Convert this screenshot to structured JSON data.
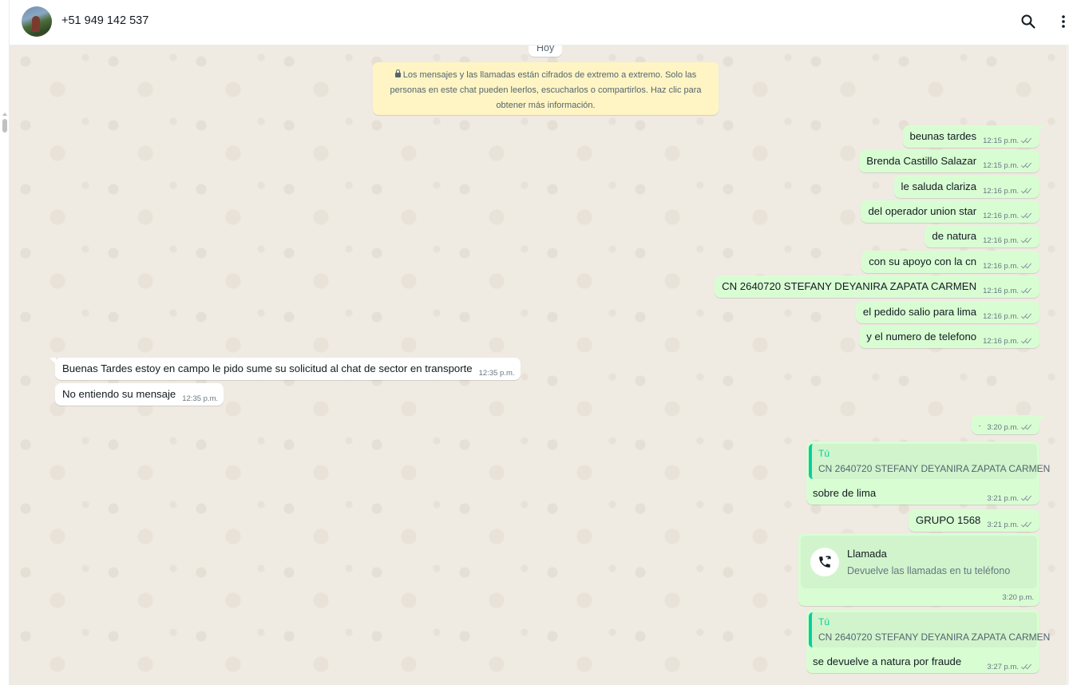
{
  "header": {
    "contact_name": "+51 949 142 537",
    "icons": [
      "search-icon",
      "menu-icon"
    ]
  },
  "chat": {
    "date_chip": "Hoy",
    "encryption_notice": "Los mensajes y las llamadas están cifrados de extremo a extremo. Solo las personas en este chat pueden leerlos, escucharlos o compartirlos. Haz clic para obtener más información.",
    "messages": [
      {
        "text": "beunas tardes",
        "time": "12:15 p.m."
      },
      {
        "text": "Brenda Castillo Salazar",
        "time": "12:15 p.m."
      },
      {
        "text": "le saluda clariza",
        "time": "12:16 p.m."
      },
      {
        "text": "del operador union star",
        "time": "12:16 p.m."
      },
      {
        "text": "de natura",
        "time": "12:16 p.m."
      },
      {
        "text": "con su apoyo con la cn",
        "time": "12:16 p.m."
      },
      {
        "text": "CN 2640720 STEFANY DEYANIRA ZAPATA CARMEN",
        "time": "12:16 p.m."
      },
      {
        "text": "el pedido salio para lima",
        "time": "12:16 p.m."
      },
      {
        "text": "y el numero de telefono",
        "time": "12:16 p.m."
      },
      {
        "text": "Buenas Tardes estoy en campo le pido sume su solicitud al chat de sector en transporte",
        "time": "12:35 p.m."
      },
      {
        "text": "No entiendo su mensaje",
        "time": "12:35 p.m."
      },
      {
        "text": ".",
        "time": "3:20 p.m."
      },
      {
        "quote_author": "Tú",
        "quote_text": "CN 2640720 STEFANY DEYANIRA ZAPATA CARMEN",
        "text": "sobre de lima",
        "time": "3:21 p.m."
      },
      {
        "text": "GRUPO 1568",
        "time": "3:21 p.m."
      },
      {
        "call_title": "Llamada",
        "call_subtitle": "Devuelve las llamadas en tu teléfono",
        "time": "3:20 p.m."
      },
      {
        "quote_author": "Tú",
        "quote_text": "CN 2640720 STEFANY DEYANIRA ZAPATA CARMEN",
        "text": "se devuelve a natura por fraude",
        "time": "3:27 p.m."
      }
    ]
  },
  "colors": {
    "outgoing_bubble": "#d9fdd3",
    "incoming_bubble": "#ffffff",
    "chat_background": "#efeae2",
    "encryption_banner": "#fff5c4",
    "quote_accent": "#06cf9c"
  }
}
